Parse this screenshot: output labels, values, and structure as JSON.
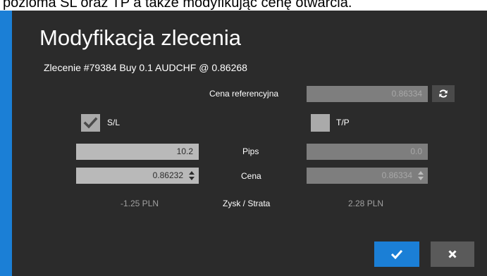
{
  "caption": "pozioma SL oraz TP a także modyfikując cenę otwarcia.",
  "dialog": {
    "title": "Modyfikacja zlecenia",
    "order_info": "Zlecenie #79384 Buy 0.1 AUDCHF @ 0.86268",
    "reference_price_label": "Cena referencyjna",
    "reference_price_value": "0.86334",
    "sl_label": "S/L",
    "sl_checked": true,
    "tp_label": "T/P",
    "tp_checked": false,
    "pips_label": "Pips",
    "sl_pips": "10.2",
    "tp_pips": "0.0",
    "price_label": "Cena",
    "sl_price": "0.86232",
    "tp_price": "0.86334",
    "profit_label": "Zysk / Strata",
    "sl_profit": "-1.25 PLN",
    "tp_profit": "2.28 PLN"
  },
  "colors": {
    "accent": "#1b7fd6",
    "dialog_bg": "#2b2b2b",
    "field_active": "#b9b9b9",
    "field_disabled": "#7e7e7e"
  },
  "icons": [
    "refresh-icon",
    "checkmark-icon",
    "spinner-arrows-icon",
    "close-x-icon"
  ]
}
